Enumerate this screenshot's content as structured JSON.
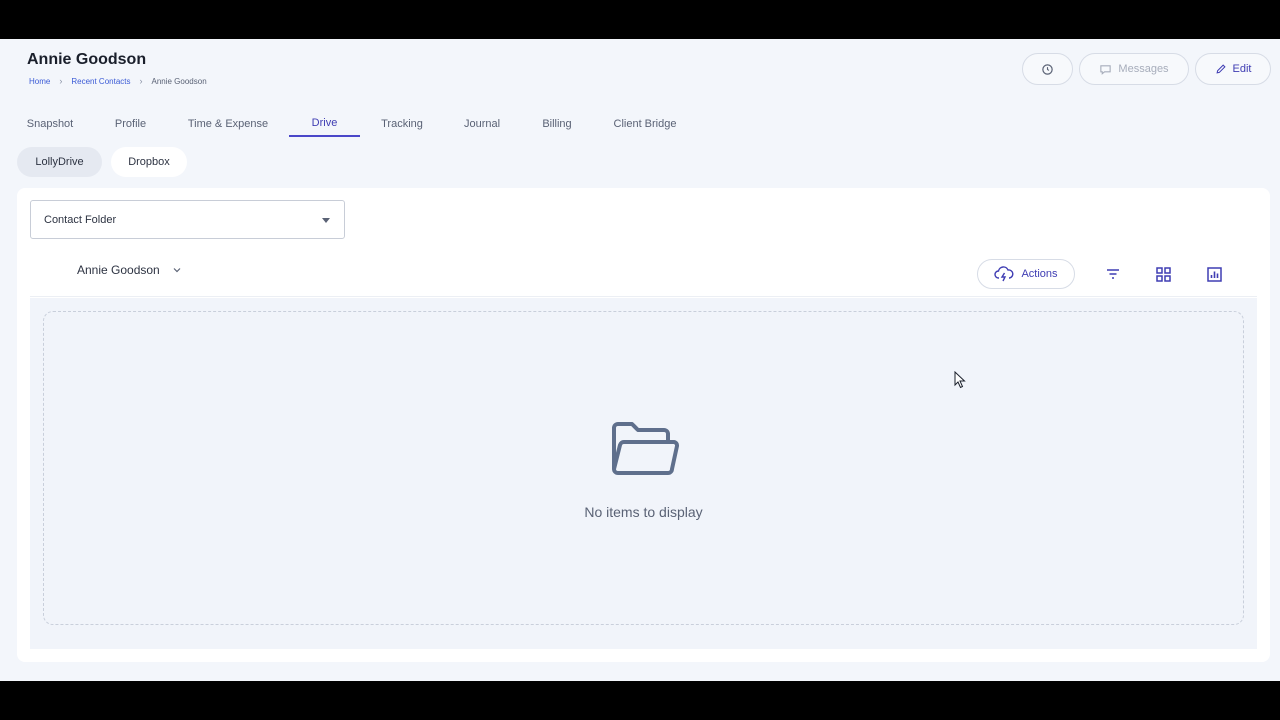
{
  "header": {
    "title": "Annie Goodson",
    "breadcrumb": [
      "Home",
      "Recent Contacts",
      "Annie Goodson"
    ],
    "buttons": {
      "messages": "Messages",
      "edit": "Edit"
    }
  },
  "tabs": [
    {
      "label": "Snapshot"
    },
    {
      "label": "Profile"
    },
    {
      "label": "Time & Expense"
    },
    {
      "label": "Drive",
      "active": true
    },
    {
      "label": "Tracking"
    },
    {
      "label": "Journal"
    },
    {
      "label": "Billing"
    },
    {
      "label": "Client Bridge"
    }
  ],
  "sources": {
    "lolly": "LollyDrive",
    "dropbox": "Dropbox",
    "selected": "LollyDrive"
  },
  "drive": {
    "folder_select": "Contact Folder",
    "owner": "Annie Goodson",
    "actions_label": "Actions",
    "empty_message": "No items to display"
  },
  "colors": {
    "accent": "#4a47c9",
    "background": "#f3f6fb",
    "card": "#ffffff"
  },
  "icons": [
    "history-icon",
    "message-icon",
    "pencil-icon",
    "chevron-down-icon",
    "cloud-bolt-icon",
    "filter-icon",
    "grid-icon",
    "chart-icon",
    "folder-open-icon"
  ]
}
